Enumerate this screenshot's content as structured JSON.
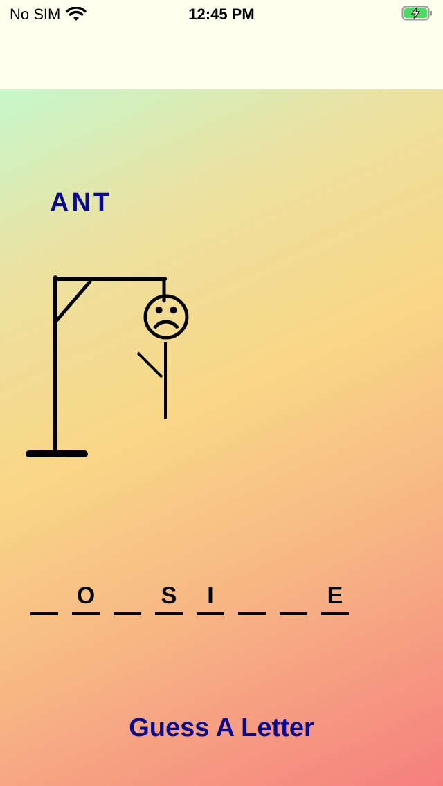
{
  "status": {
    "carrier": "No SIM",
    "time": "12:45 PM",
    "wifi_icon": "wifi-icon",
    "battery_icon": "battery-charging-icon"
  },
  "game": {
    "missed_letters": "ANT",
    "word_slots": [
      "",
      "O",
      "",
      "S",
      "I",
      "",
      "",
      "E"
    ],
    "face": "☹",
    "guess_button_label": "Guess A Letter"
  },
  "colors": {
    "accent": "#0a0a8c",
    "battery_fill": "#4cd964"
  }
}
